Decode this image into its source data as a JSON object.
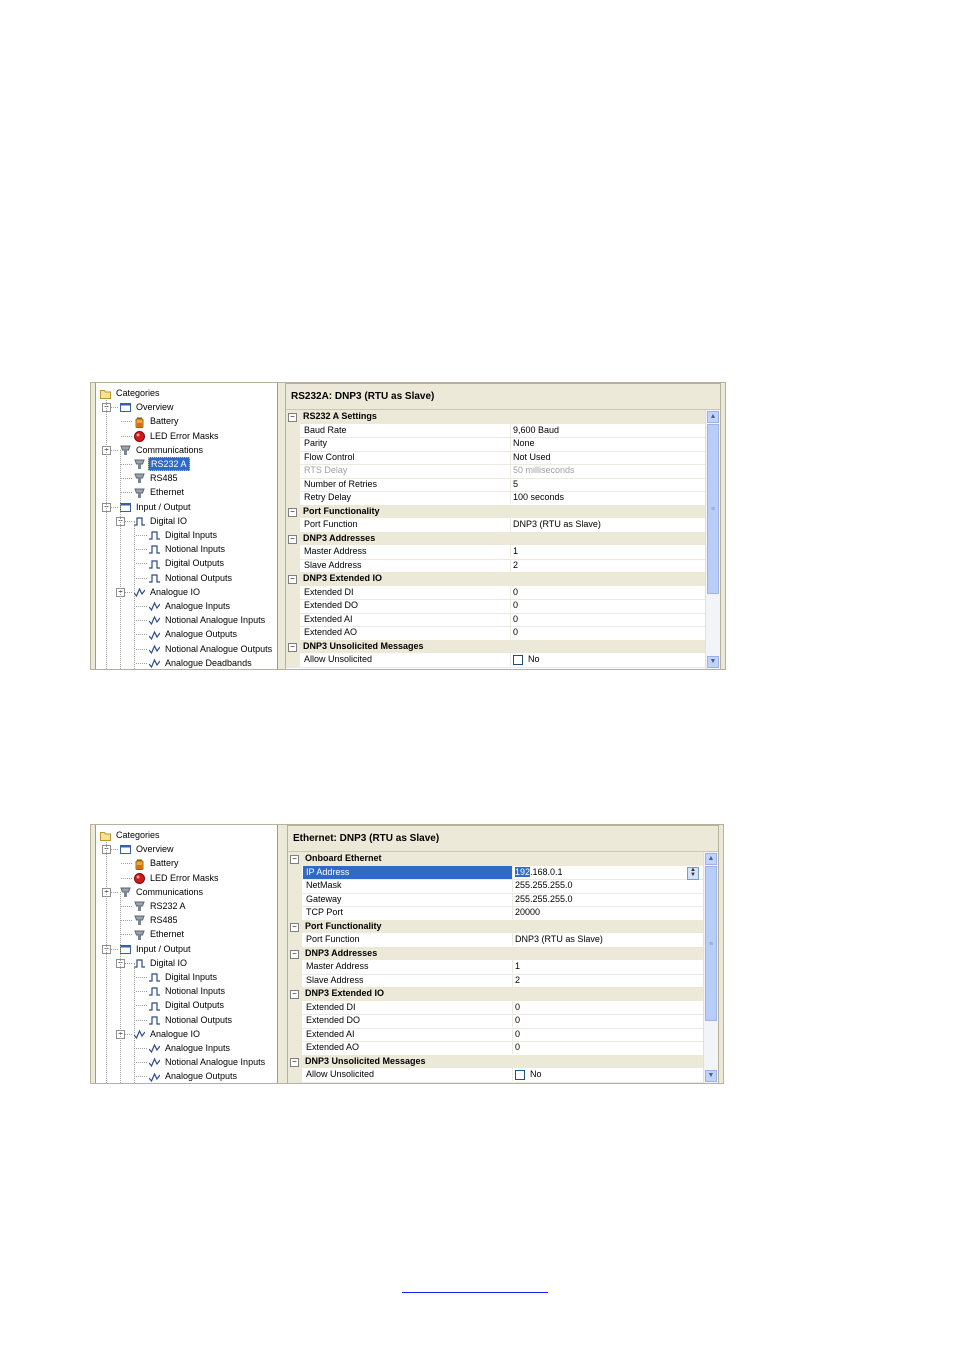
{
  "screens": [
    {
      "tree": {
        "root": "Categories",
        "items": [
          {
            "label": "Overview",
            "icon": "window-icon",
            "level": 1,
            "expander": "-"
          },
          {
            "label": "Battery",
            "icon": "battery-icon",
            "level": 2
          },
          {
            "label": "LED Error Masks",
            "icon": "led-icon",
            "level": 2
          },
          {
            "label": "Communications",
            "icon": "port-icon",
            "level": 1,
            "expander": "-"
          },
          {
            "label": "RS232 A",
            "icon": "port-icon",
            "level": 2,
            "selected": true
          },
          {
            "label": "RS485",
            "icon": "port-icon",
            "level": 2
          },
          {
            "label": "Ethernet",
            "icon": "port-icon",
            "level": 2
          },
          {
            "label": "Input / Output",
            "icon": "window-icon",
            "level": 1,
            "expander": "-"
          },
          {
            "label": "Digital IO",
            "icon": "digital-signal-icon",
            "level": 2,
            "expander": "-"
          },
          {
            "label": "Digital Inputs",
            "icon": "digital-signal-icon",
            "level": 3
          },
          {
            "label": "Notional Inputs",
            "icon": "digital-signal-icon",
            "level": 3
          },
          {
            "label": "Digital Outputs",
            "icon": "digital-signal-icon",
            "level": 3
          },
          {
            "label": "Notional Outputs",
            "icon": "digital-signal-icon",
            "level": 3
          },
          {
            "label": "Analogue IO",
            "icon": "analogue-signal-icon",
            "level": 2,
            "expander": "-"
          },
          {
            "label": "Analogue Inputs",
            "icon": "analogue-signal-icon",
            "level": 3
          },
          {
            "label": "Notional Analogue Inputs",
            "icon": "analogue-signal-icon",
            "level": 3
          },
          {
            "label": "Analogue Outputs",
            "icon": "analogue-signal-icon",
            "level": 3
          },
          {
            "label": "Notional Analogue Outputs",
            "icon": "analogue-signal-icon",
            "level": 3
          },
          {
            "label": "Analogue Deadbands",
            "icon": "analogue-signal-icon",
            "level": 3
          }
        ]
      },
      "title": "RS232A: DNP3 (RTU as Slave)",
      "rows": [
        {
          "type": "category",
          "name": "RS232 A Settings"
        },
        {
          "name": "Baud Rate",
          "value": "9,600 Baud"
        },
        {
          "name": "Parity",
          "value": "None"
        },
        {
          "name": "Flow Control",
          "value": "Not Used"
        },
        {
          "name": "RTS Delay",
          "value": "50 milliseconds",
          "disabled": true
        },
        {
          "name": "Number of Retries",
          "value": "5"
        },
        {
          "name": "Retry Delay",
          "value": "100 seconds"
        },
        {
          "type": "category",
          "name": "Port Functionality"
        },
        {
          "name": "Port Function",
          "value": "DNP3 (RTU as Slave)"
        },
        {
          "type": "category",
          "name": "DNP3 Addresses"
        },
        {
          "name": "Master Address",
          "value": "1"
        },
        {
          "name": "Slave Address",
          "value": "2"
        },
        {
          "type": "category",
          "name": "DNP3 Extended IO"
        },
        {
          "name": "Extended DI",
          "value": "0"
        },
        {
          "name": "Extended DO",
          "value": "0"
        },
        {
          "name": "Extended AI",
          "value": "0"
        },
        {
          "name": "Extended AO",
          "value": "0"
        },
        {
          "type": "category",
          "name": "DNP3 Unsolicited Messages"
        },
        {
          "name": "Allow Unsolicited",
          "value": "No",
          "checkbox": true
        }
      ]
    },
    {
      "tree": {
        "root": "Categories",
        "items": [
          {
            "label": "Overview",
            "icon": "window-icon",
            "level": 1,
            "expander": "-"
          },
          {
            "label": "Battery",
            "icon": "battery-icon",
            "level": 2
          },
          {
            "label": "LED Error Masks",
            "icon": "led-icon",
            "level": 2
          },
          {
            "label": "Communications",
            "icon": "port-icon",
            "level": 1,
            "expander": "-"
          },
          {
            "label": "RS232 A",
            "icon": "port-icon",
            "level": 2
          },
          {
            "label": "RS485",
            "icon": "port-icon",
            "level": 2
          },
          {
            "label": "Ethernet",
            "icon": "port-icon",
            "level": 2
          },
          {
            "label": "Input / Output",
            "icon": "window-icon",
            "level": 1,
            "expander": "-"
          },
          {
            "label": "Digital IO",
            "icon": "digital-signal-icon",
            "level": 2,
            "expander": "-"
          },
          {
            "label": "Digital Inputs",
            "icon": "digital-signal-icon",
            "level": 3
          },
          {
            "label": "Notional Inputs",
            "icon": "digital-signal-icon",
            "level": 3
          },
          {
            "label": "Digital Outputs",
            "icon": "digital-signal-icon",
            "level": 3
          },
          {
            "label": "Notional Outputs",
            "icon": "digital-signal-icon",
            "level": 3
          },
          {
            "label": "Analogue IO",
            "icon": "analogue-signal-icon",
            "level": 2,
            "expander": "-"
          },
          {
            "label": "Analogue Inputs",
            "icon": "analogue-signal-icon",
            "level": 3
          },
          {
            "label": "Notional Analogue Inputs",
            "icon": "analogue-signal-icon",
            "level": 3
          },
          {
            "label": "Analogue Outputs",
            "icon": "analogue-signal-icon",
            "level": 3
          }
        ]
      },
      "title": "Ethernet: DNP3 (RTU as Slave)",
      "rows": [
        {
          "type": "category",
          "name": "Onboard Ethernet"
        },
        {
          "name": "IP Address",
          "value_sel": "192",
          "value": ".168.0.1",
          "highlight": true,
          "spinner": true
        },
        {
          "name": "NetMask",
          "value": "255.255.255.0"
        },
        {
          "name": "Gateway",
          "value": "255.255.255.0"
        },
        {
          "name": "TCP Port",
          "value": "20000"
        },
        {
          "type": "category",
          "name": "Port Functionality"
        },
        {
          "name": "Port Function",
          "value": "DNP3 (RTU as Slave)"
        },
        {
          "type": "category",
          "name": "DNP3 Addresses"
        },
        {
          "name": "Master Address",
          "value": "1"
        },
        {
          "name": "Slave Address",
          "value": "2"
        },
        {
          "type": "category",
          "name": "DNP3 Extended IO"
        },
        {
          "name": "Extended DI",
          "value": "0"
        },
        {
          "name": "Extended DO",
          "value": "0"
        },
        {
          "name": "Extended AI",
          "value": "0"
        },
        {
          "name": "Extended AO",
          "value": "0"
        },
        {
          "type": "category",
          "name": "DNP3 Unsolicited Messages"
        },
        {
          "name": "Allow Unsolicited",
          "value": "No",
          "checkbox": true
        }
      ]
    }
  ]
}
